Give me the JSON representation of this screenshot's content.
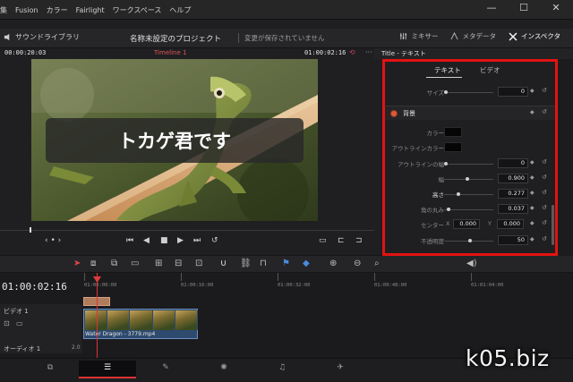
{
  "menu": {
    "items": [
      "集",
      "Fusion",
      "カラー",
      "Fairlight",
      "ワークスペース",
      "ヘルプ"
    ]
  },
  "window": {
    "minimize": "—",
    "maximize": "☐",
    "close": "✕"
  },
  "toolbar": {
    "sound_library": "サウンドライブラリ",
    "project_name": "名称未設定のプロジェクト",
    "saved_status": "変更が保存されていません",
    "mixer": "ミキサー",
    "metadata": "メタデータ",
    "inspector": "インスペクタ"
  },
  "viewer": {
    "timecode_left": "00:00:20:03",
    "timeline_name": "Timeline 1",
    "timecode_right": "01:00:02:16",
    "caption": "トカゲ君です"
  },
  "inspector_panel": {
    "header": "Title - テキスト",
    "tabs": [
      "テキスト",
      "ビデオ"
    ],
    "active_tab": "テキスト",
    "size_label": "サイズ",
    "size_value": "0",
    "section_title": "背景",
    "color_label": "カラー",
    "outline_color_label": "アウトラインカラー",
    "outline_width_label": "アウトラインの幅",
    "outline_width_value": "0",
    "width_label": "幅",
    "width_value": "0.900",
    "height_label": "高さ",
    "height_value": "0.277",
    "corner_label": "角の丸み",
    "corner_value": "0.037",
    "center_label": "センター",
    "center_x_label": "X",
    "center_x_value": "0.000",
    "center_y_label": "Y",
    "center_y_value": "0.000",
    "opacity_label": "不透明度",
    "opacity_value": "50",
    "colors": {
      "highlight_border": "#e31212",
      "swatch": "#050505"
    }
  },
  "timeline": {
    "timecode": "01:00:02:16",
    "ruler_labels": [
      "01:00:00:00",
      "01:00:16:00",
      "01:00:32:00",
      "01:00:48:00",
      "01:01:04:00"
    ],
    "video_track": "ビデオ 1",
    "clip_name": "Water Dragon - 3779.mp4",
    "audio_track": "オーディオ 1",
    "audio_db": "2.0"
  },
  "watermark": "k05.biz"
}
